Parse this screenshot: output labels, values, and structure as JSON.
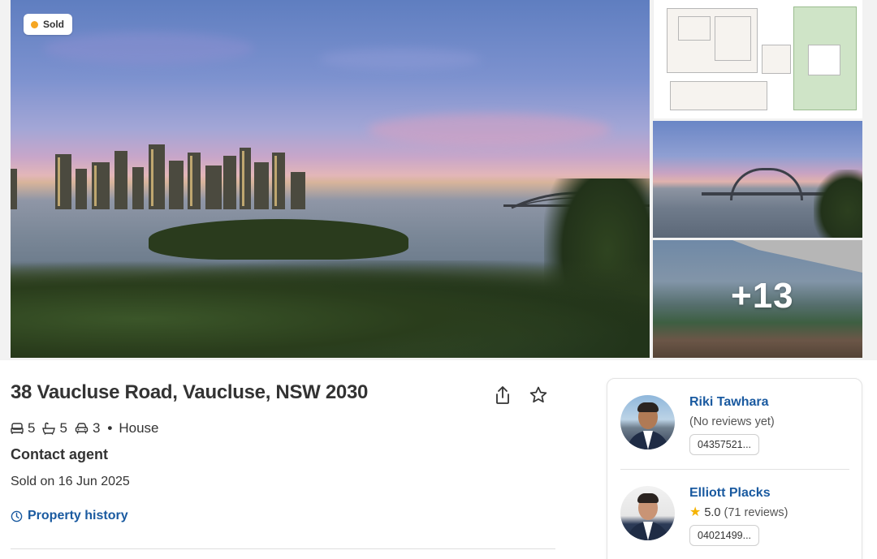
{
  "gallery": {
    "status_badge": "Sold",
    "status_color": "#f5a623",
    "more_photos": "+13"
  },
  "listing": {
    "address": "38 Vaucluse Road, Vaucluse, NSW 2030",
    "bedrooms": "5",
    "bathrooms": "5",
    "car_spaces": "3",
    "property_type": "House",
    "price": "Contact agent",
    "sold_date": "Sold on 16 Jun 2025",
    "history_link": "Property history"
  },
  "agents": [
    {
      "name": "Riki Tawhara",
      "reviews": "(No reviews yet)",
      "phone": "04357521..."
    },
    {
      "name": "Elliott Placks",
      "rating": "5.0",
      "reviews": "(71 reviews)",
      "phone": "04021499..."
    }
  ],
  "colors": {
    "link": "#1a5aa0",
    "star": "#f5b301"
  }
}
